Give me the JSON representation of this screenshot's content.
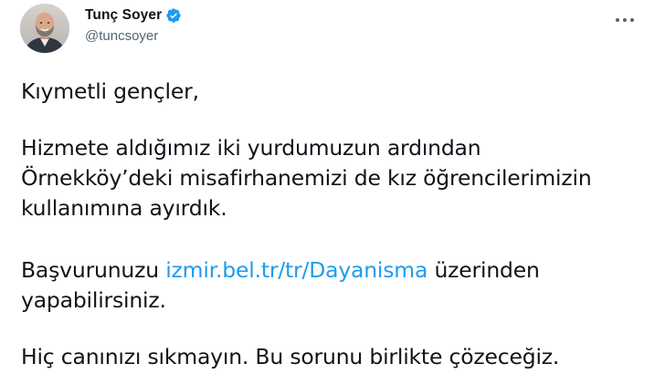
{
  "author": {
    "display_name": "Tunç Soyer",
    "handle": "@tuncsoyer",
    "verified": true,
    "avatar_icon": "profile-photo"
  },
  "menu": {
    "more_icon": "more-horizontal-icon"
  },
  "tweet": {
    "p1": "Kıymetli gençler,",
    "p2_line1": "Hizmete aldığımız iki yurdumuzun ardından",
    "p2_line2": "Örnekköy’deki misafirhanemizi de kız öğrencilerimizin",
    "p2_line3": "kullanımına ayırdık.",
    "p3_before": "Başvurunuzu ",
    "p3_link": "izmir.bel.tr/tr/Dayanisma",
    "p3_after": " üzerinden",
    "p3_line2": "yapabilirsiniz.",
    "p4": "Hiç canınızı sıkmayın. Bu sorunu birlikte çözeceğiz."
  },
  "colors": {
    "link": "#1d9bf0",
    "verified_badge": "#1d9bf0",
    "text": "#0f1419",
    "secondary_text": "#536471"
  }
}
